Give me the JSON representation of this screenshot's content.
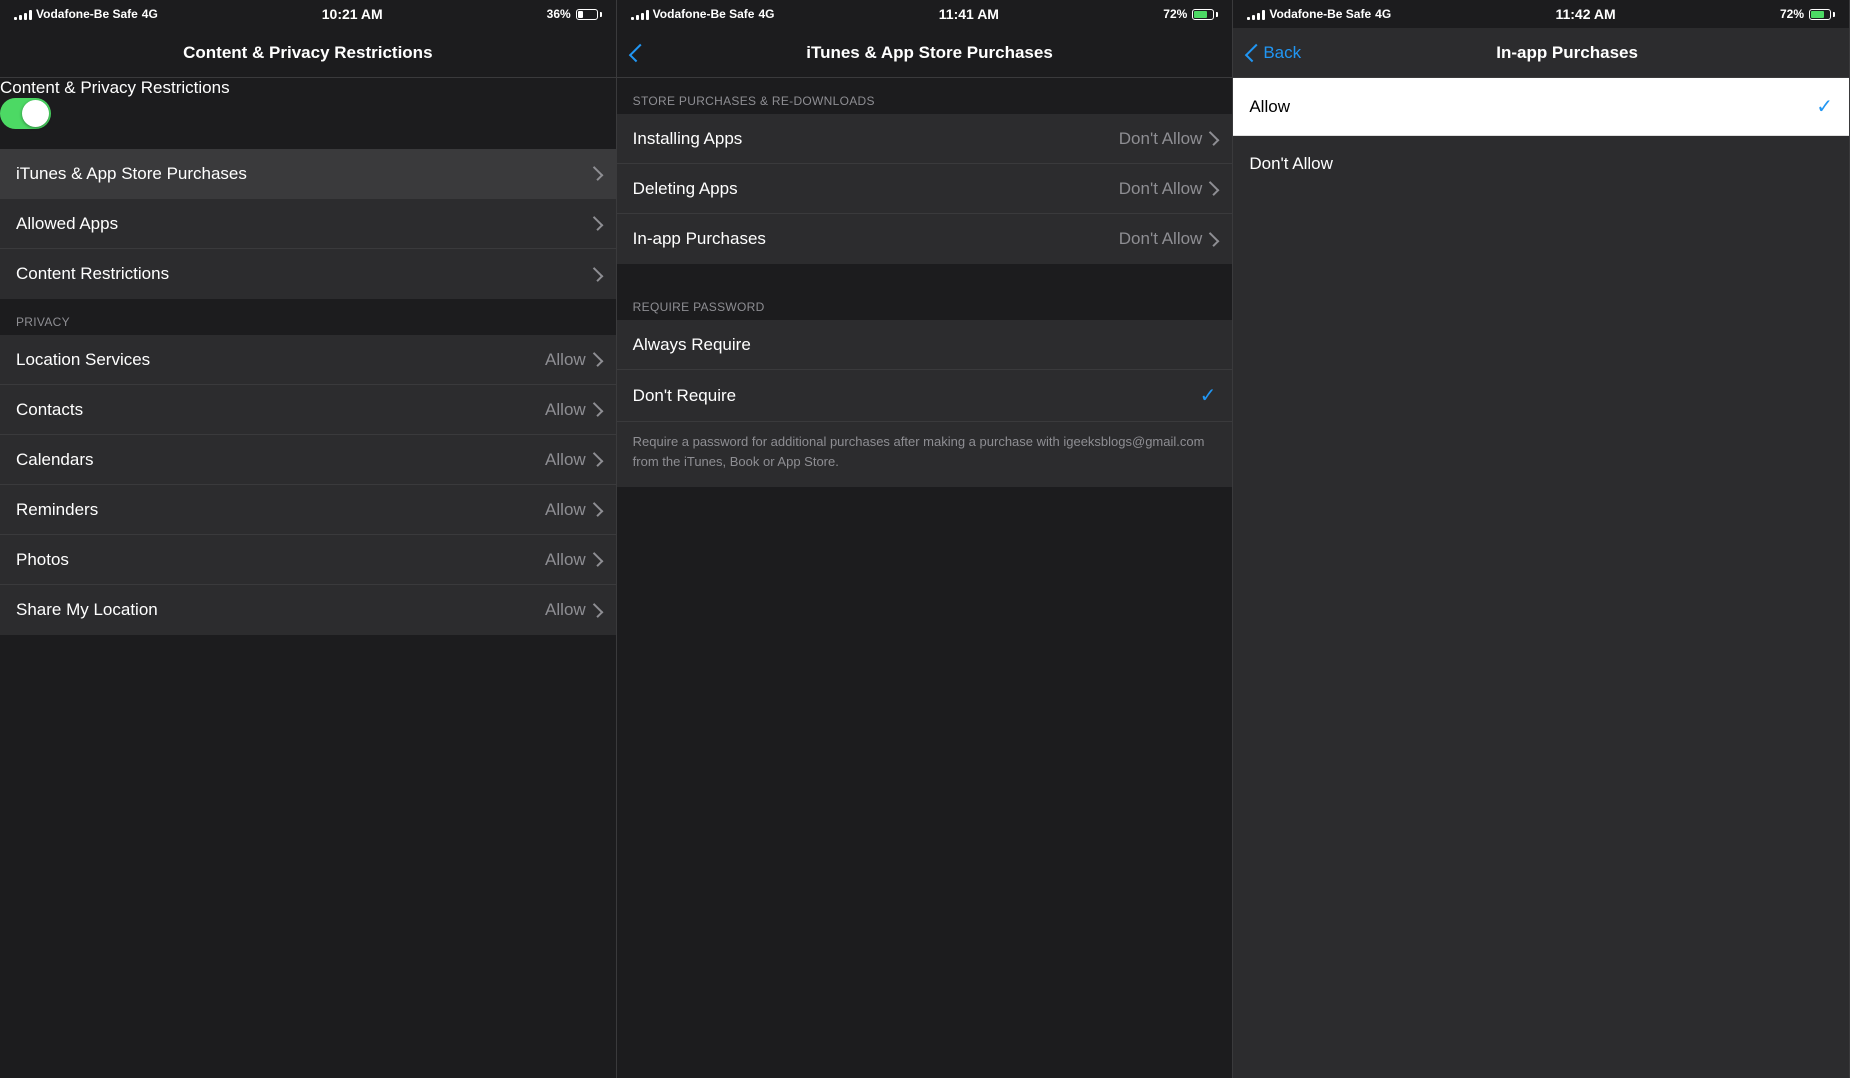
{
  "panels": [
    {
      "id": "panel1",
      "statusBar": {
        "carrier": "Vodafone-Be Safe",
        "network": "4G",
        "time": "10:21 AM",
        "batteryLevel": "36%",
        "batteryType": "low"
      },
      "navTitle": "Content & Privacy Restrictions",
      "hasBack": false,
      "contentRestrictionsLabel": "Content & Privacy Restrictions",
      "menuItems": [
        {
          "label": "iTunes & App Store Purchases",
          "hasChevron": true,
          "rightText": "",
          "selected": true
        },
        {
          "label": "Allowed Apps",
          "hasChevron": true,
          "rightText": ""
        },
        {
          "label": "Content Restrictions",
          "hasChevron": true,
          "rightText": ""
        }
      ],
      "privacySectionHeader": "PRIVACY",
      "privacyItems": [
        {
          "label": "Location Services",
          "rightText": "Allow",
          "hasChevron": true
        },
        {
          "label": "Contacts",
          "rightText": "Allow",
          "hasChevron": true
        },
        {
          "label": "Calendars",
          "rightText": "Allow",
          "hasChevron": true
        },
        {
          "label": "Reminders",
          "rightText": "Allow",
          "hasChevron": true
        },
        {
          "label": "Photos",
          "rightText": "Allow",
          "hasChevron": true
        },
        {
          "label": "Share My Location",
          "rightText": "Allow",
          "hasChevron": true
        }
      ]
    },
    {
      "id": "panel2",
      "statusBar": {
        "carrier": "Vodafone-Be Safe",
        "network": "4G",
        "time": "11:41 AM",
        "batteryLevel": "72%",
        "batteryType": "high"
      },
      "navTitle": "iTunes & App Store Purchases",
      "backLabel": "",
      "hasBack": true,
      "storeSectionHeader": "STORE PURCHASES & RE-DOWNLOADS",
      "storeItems": [
        {
          "label": "Installing Apps",
          "rightText": "Don't Allow",
          "hasChevron": true,
          "selected": false
        },
        {
          "label": "Deleting Apps",
          "rightText": "Don't Allow",
          "hasChevron": true,
          "selected": false
        },
        {
          "label": "In-app Purchases",
          "rightText": "Don't Allow",
          "hasChevron": true,
          "selected": true
        }
      ],
      "requirePwSectionHeader": "REQUIRE PASSWORD",
      "requirePwItems": [
        {
          "label": "Always Require",
          "hasChevron": false,
          "hasCheck": false
        },
        {
          "label": "Don't Require",
          "hasChevron": false,
          "hasCheck": true
        }
      ],
      "requirePwDescription": "Require a password for additional purchases after making a purchase with igeeksblogs@gmail.com from the iTunes, Book or App Store."
    },
    {
      "id": "panel3",
      "statusBar": {
        "carrier": "Vodafone-Be Safe",
        "network": "4G",
        "time": "11:42 AM",
        "batteryLevel": "72%",
        "batteryType": "high"
      },
      "navTitle": "In-app Purchases",
      "backLabel": "Back",
      "hasBack": true,
      "allowOption": {
        "label": "Allow",
        "selected": true
      },
      "dontAllowOption": {
        "label": "Don't Allow",
        "selected": false
      }
    }
  ]
}
